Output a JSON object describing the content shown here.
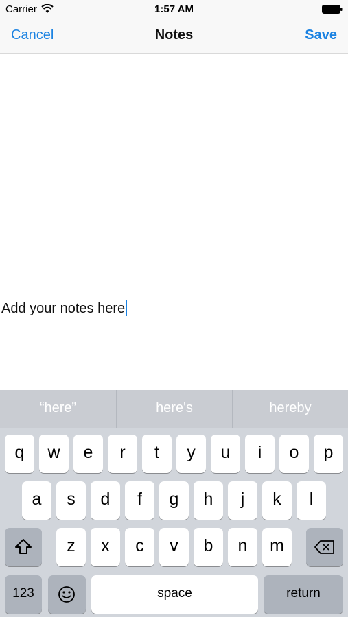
{
  "status_bar": {
    "carrier": "Carrier",
    "time": "1:57 AM"
  },
  "nav": {
    "cancel_label": "Cancel",
    "title": "Notes",
    "save_label": "Save"
  },
  "notes": {
    "text": "Add your notes here"
  },
  "keyboard": {
    "suggestions": [
      "“here”",
      "here's",
      "hereby"
    ],
    "row1": [
      "q",
      "w",
      "e",
      "r",
      "t",
      "y",
      "u",
      "i",
      "o",
      "p"
    ],
    "row2": [
      "a",
      "s",
      "d",
      "f",
      "g",
      "h",
      "j",
      "k",
      "l"
    ],
    "row3": [
      "z",
      "x",
      "c",
      "v",
      "b",
      "n",
      "m"
    ],
    "numbers_label": "123",
    "space_label": "space",
    "return_label": "return"
  },
  "colors": {
    "accent": "#1a82e2",
    "keyboard_bg": "#d1d5db",
    "suggestion_bar_bg": "#c9ccd2"
  }
}
